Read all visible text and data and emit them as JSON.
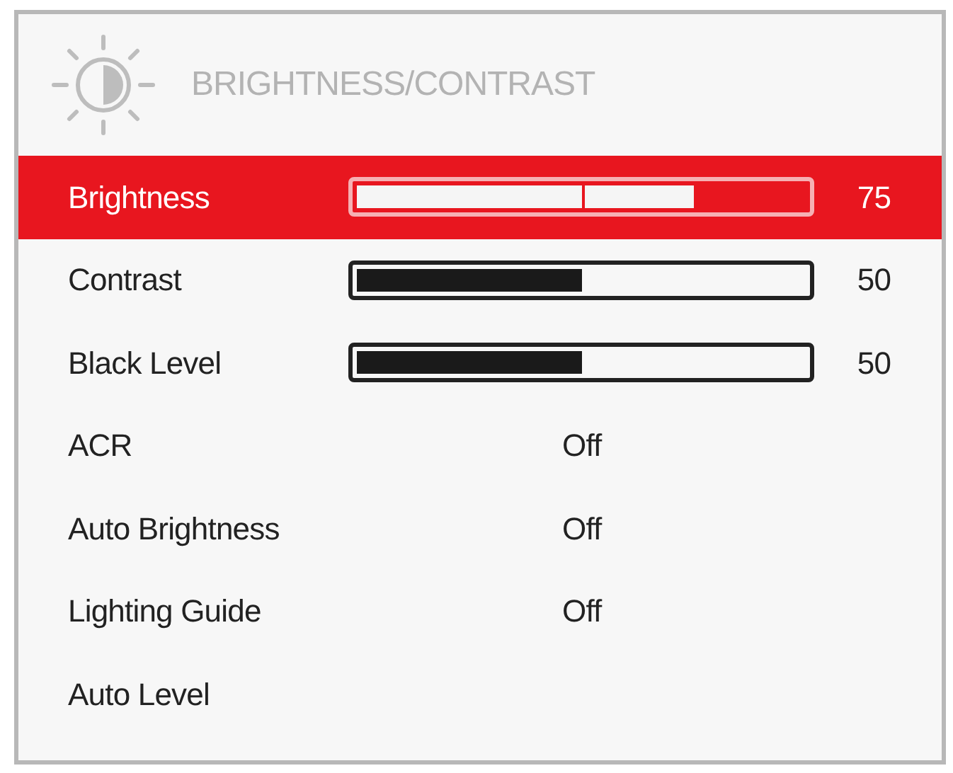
{
  "menu": {
    "title": "BRIGHTNESS/CONTRAST",
    "items": [
      {
        "kind": "slider",
        "label": "Brightness",
        "level": 0.75,
        "reading": "75",
        "selected": true
      },
      {
        "kind": "slider",
        "label": "Contrast",
        "level": 0.5,
        "reading": "50",
        "selected": false
      },
      {
        "kind": "slider",
        "label": "Black Level",
        "level": 0.5,
        "reading": "50",
        "selected": false
      },
      {
        "kind": "option",
        "label": "ACR",
        "value": "Off",
        "selected": false
      },
      {
        "kind": "option",
        "label": "Auto Brightness",
        "value": "Off",
        "selected": false
      },
      {
        "kind": "option",
        "label": "Lighting Guide",
        "value": "Off",
        "selected": false
      },
      {
        "kind": "action",
        "label": "Auto Level",
        "selected": false
      }
    ]
  }
}
